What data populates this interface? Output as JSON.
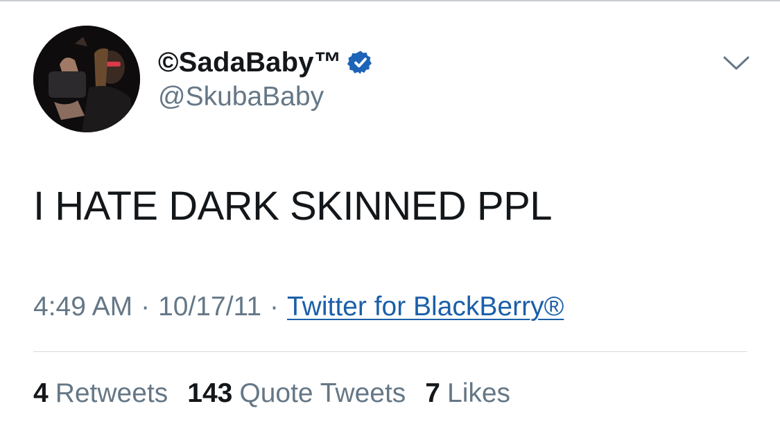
{
  "tweet": {
    "author": {
      "display_name": "©SadaBaby™",
      "handle": "@SkubaBaby",
      "verified": true,
      "avatar": "profile-photo"
    },
    "text": "I HATE DARK SKINNED PPL",
    "meta": {
      "time": "4:49 AM",
      "separator": "·",
      "date": "10/17/11",
      "source": "Twitter for BlackBerry®"
    },
    "stats": [
      {
        "count": "4",
        "label": "Retweets"
      },
      {
        "count": "143",
        "label": "Quote Tweets"
      },
      {
        "count": "7",
        "label": "Likes"
      }
    ],
    "icons": {
      "verified": "verified-badge-icon",
      "more": "chevron-down-icon"
    },
    "colors": {
      "text": "#14171a",
      "secondary": "#657786",
      "link": "#1b5fa8",
      "verified": "#1d63b8"
    }
  }
}
